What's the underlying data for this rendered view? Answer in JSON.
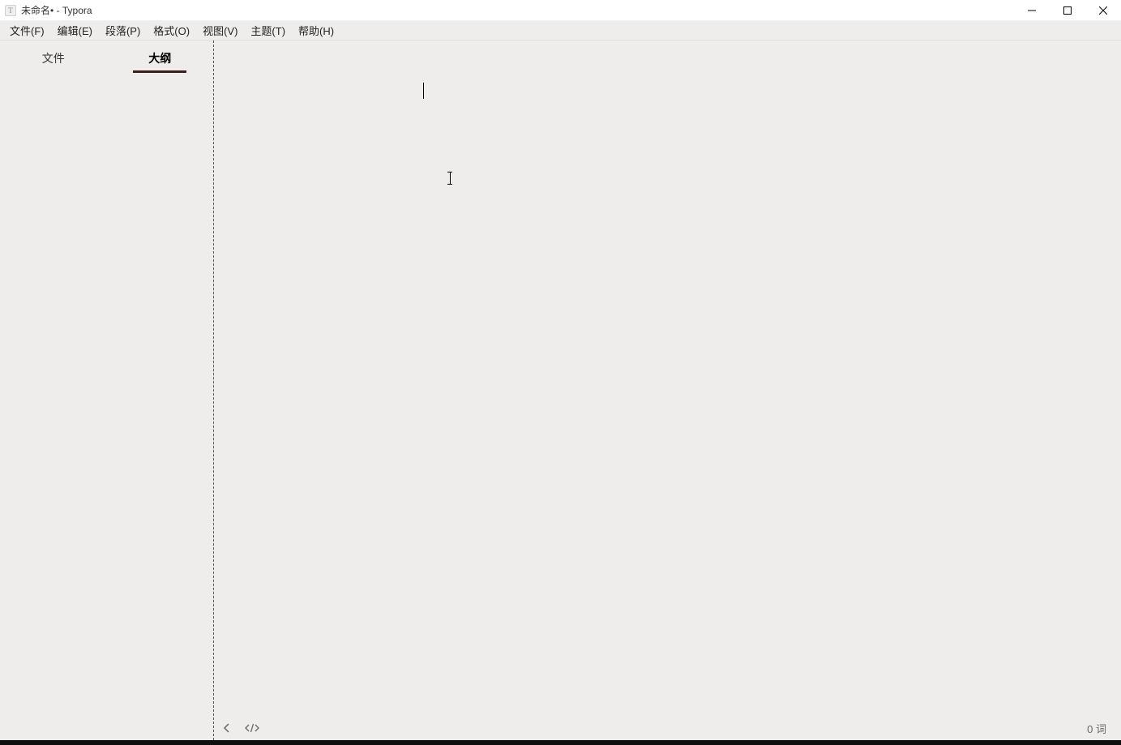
{
  "window": {
    "app_icon_letter": "T",
    "title": "未命名• - Typora"
  },
  "menu": {
    "file": "文件(F)",
    "edit": "编辑(E)",
    "paragraph": "段落(P)",
    "format": "格式(O)",
    "view": "视图(V)",
    "theme": "主题(T)",
    "help": "帮助(H)"
  },
  "sidebar": {
    "tab_files": "文件",
    "tab_outline": "大纲"
  },
  "status": {
    "word_count": "0 词"
  }
}
